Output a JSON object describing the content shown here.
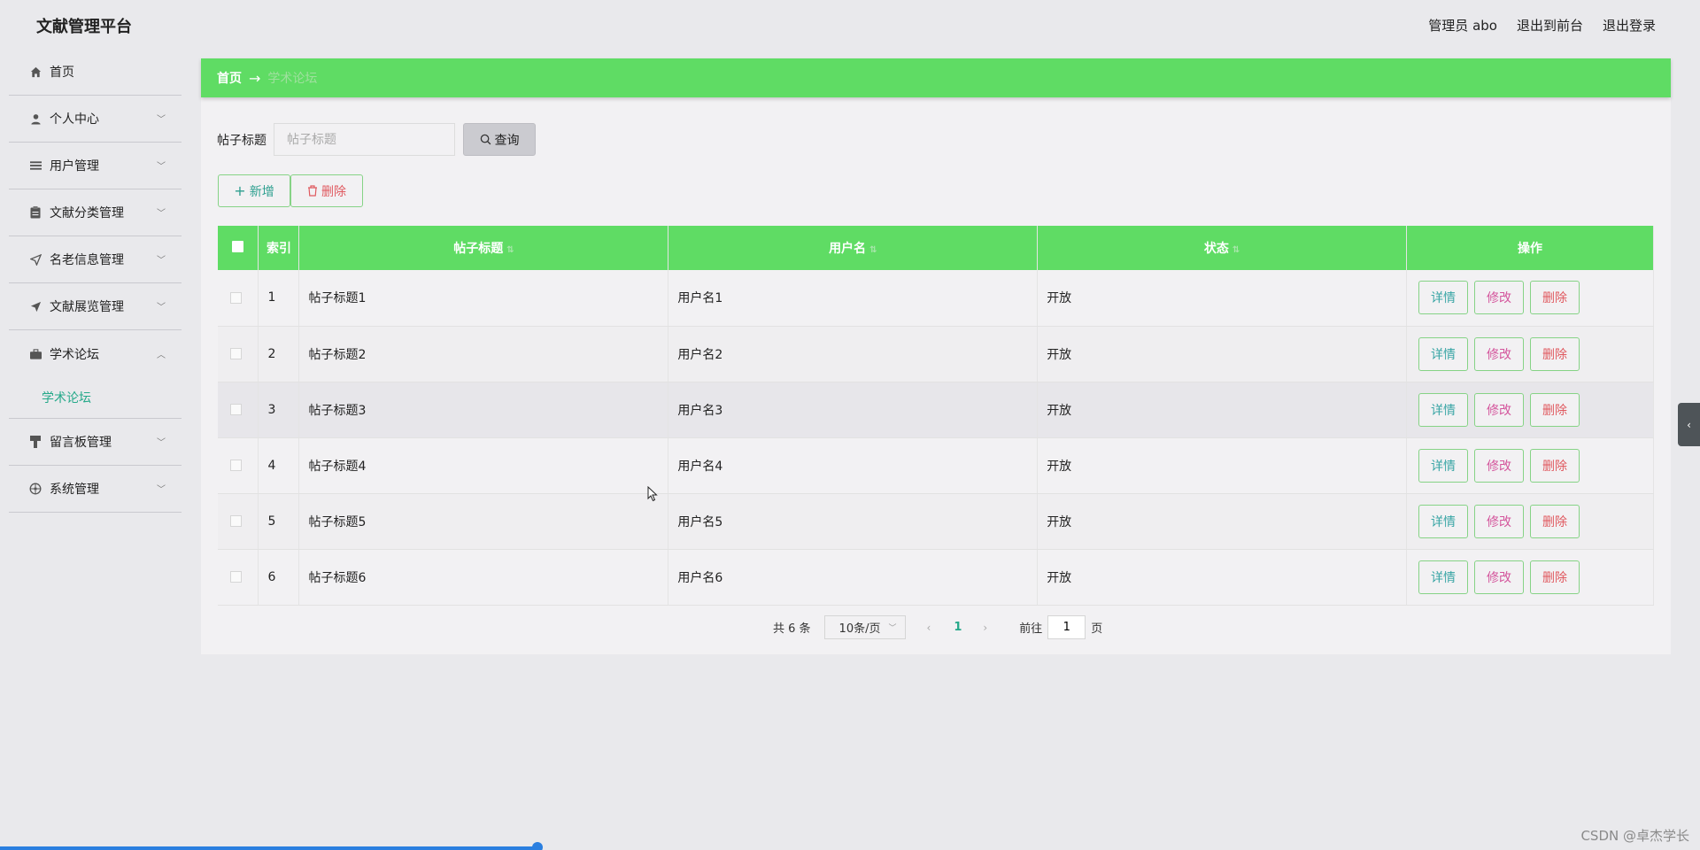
{
  "app": {
    "title": "文献管理平台"
  },
  "header": {
    "user": "管理员 abo",
    "to_front": "退出到前台",
    "logout": "退出登录"
  },
  "sidebar": {
    "items": [
      {
        "label": "首页",
        "icon": "home-icon"
      },
      {
        "label": "个人中心",
        "icon": "user-icon"
      },
      {
        "label": "用户管理",
        "icon": "list-icon"
      },
      {
        "label": "文献分类管理",
        "icon": "clipboard-icon"
      },
      {
        "label": "名老信息管理",
        "icon": "send-icon"
      },
      {
        "label": "文献展览管理",
        "icon": "paper-plane-icon"
      },
      {
        "label": "学术论坛",
        "icon": "briefcase-icon"
      },
      {
        "label": "留言板管理",
        "icon": "brush-icon"
      },
      {
        "label": "系统管理",
        "icon": "settings-icon"
      }
    ],
    "sub_active": "学术论坛"
  },
  "breadcrumb": {
    "home": "首页",
    "arrow": "→",
    "current": "学术论坛"
  },
  "search": {
    "label": "帖子标题",
    "placeholder": "帖子标题",
    "button": "查询"
  },
  "actions": {
    "add": "新增",
    "delete": "删除"
  },
  "table": {
    "columns": [
      "索引",
      "帖子标题",
      "用户名",
      "状态",
      "操作"
    ],
    "rows": [
      {
        "index": "1",
        "title": "帖子标题1",
        "user": "用户名1",
        "status": "开放"
      },
      {
        "index": "2",
        "title": "帖子标题2",
        "user": "用户名2",
        "status": "开放"
      },
      {
        "index": "3",
        "title": "帖子标题3",
        "user": "用户名3",
        "status": "开放"
      },
      {
        "index": "4",
        "title": "帖子标题4",
        "user": "用户名4",
        "status": "开放"
      },
      {
        "index": "5",
        "title": "帖子标题5",
        "user": "用户名5",
        "status": "开放"
      },
      {
        "index": "6",
        "title": "帖子标题6",
        "user": "用户名6",
        "status": "开放"
      }
    ],
    "ops": {
      "detail": "详情",
      "edit": "修改",
      "delete": "删除"
    }
  },
  "pagination": {
    "total": "共 6 条",
    "page_size": "10条/页",
    "current_page": "1",
    "goto_label": "前往",
    "goto_value": "1",
    "page_suffix": "页"
  },
  "watermark": "CSDN @卓杰学长",
  "colors": {
    "accent_green": "#5fdc64",
    "teal": "#26a98a",
    "danger": "#e0595f",
    "edit": "#d4559c"
  }
}
